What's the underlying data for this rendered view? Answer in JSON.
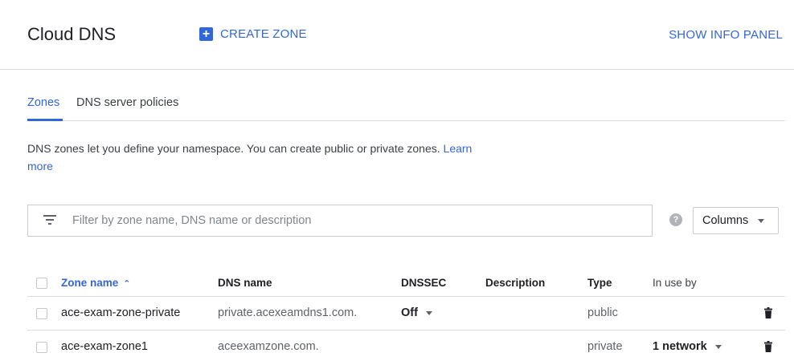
{
  "header": {
    "title": "Cloud DNS",
    "create_zone_label": "CREATE ZONE",
    "create_zone_icon": "add-box-icon",
    "show_info_label": "SHOW INFO PANEL"
  },
  "tabs": [
    {
      "label": "Zones",
      "active": true
    },
    {
      "label": "DNS server policies",
      "active": false
    }
  ],
  "description": {
    "text": "DNS zones let you define your namespace. You can create public or private zones.",
    "link": "Learn more"
  },
  "filter": {
    "placeholder": "Filter by zone name, DNS name or description",
    "value": "",
    "columns_label": "Columns"
  },
  "table": {
    "headers": {
      "zone_name": "Zone name",
      "dns_name": "DNS name",
      "dnssec": "DNSSEC",
      "description": "Description",
      "type": "Type",
      "in_use_by": "In use by"
    },
    "sort_column": "zone_name",
    "sort_direction": "ascending",
    "rows": [
      {
        "zone_name": "ace-exam-zone-private",
        "dns_name": "private.acexeamdns1.com.",
        "dnssec": "Off",
        "description": "",
        "type": "public",
        "in_use_by": ""
      },
      {
        "zone_name": "ace-exam-zone1",
        "dns_name": "aceexamzone.com.",
        "dnssec": "",
        "description": "",
        "type": "private",
        "in_use_by": "1 network"
      }
    ]
  },
  "colors": {
    "accent": "#3367d6",
    "divider": "#dadce0"
  }
}
